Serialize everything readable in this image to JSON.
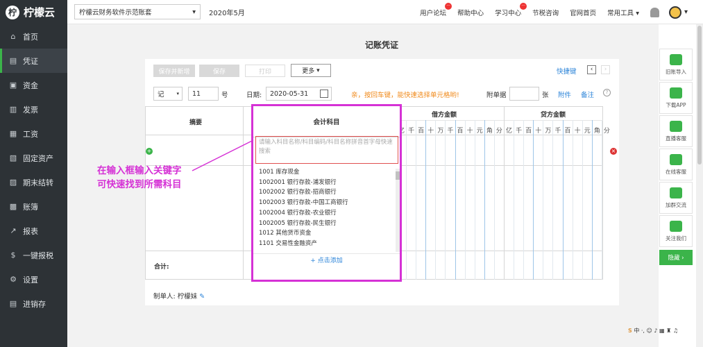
{
  "brand": {
    "name": "柠檬云",
    "logo_glyph": "柠"
  },
  "sidebar": {
    "items": [
      {
        "label": "首页",
        "icon": "home-icon",
        "glyph": "⌂"
      },
      {
        "label": "凭证",
        "icon": "voucher-icon",
        "glyph": "▤"
      },
      {
        "label": "资金",
        "icon": "funds-icon",
        "glyph": "▣"
      },
      {
        "label": "发票",
        "icon": "invoice-icon",
        "glyph": "▥"
      },
      {
        "label": "工资",
        "icon": "salary-icon",
        "glyph": "▦"
      },
      {
        "label": "固定资产",
        "icon": "asset-icon",
        "glyph": "▧"
      },
      {
        "label": "期末结转",
        "icon": "closing-icon",
        "glyph": "▨"
      },
      {
        "label": "账簿",
        "icon": "ledger-icon",
        "glyph": "▩"
      },
      {
        "label": "报表",
        "icon": "report-icon",
        "glyph": "↗"
      },
      {
        "label": "一键报税",
        "icon": "tax-icon",
        "glyph": "$"
      },
      {
        "label": "设置",
        "icon": "gear-icon",
        "glyph": "⚙"
      },
      {
        "label": "进销存",
        "icon": "inventory-icon",
        "glyph": "▤"
      }
    ]
  },
  "topbar": {
    "account": "柠檬云财务软件示范账套",
    "period": "2020年5月",
    "links": [
      "用户论坛",
      "帮助中心",
      "学习中心",
      "节税咨询",
      "官网首页",
      "常用工具"
    ],
    "badge": "···"
  },
  "voucher": {
    "title": "记账凭证",
    "btn_save_new": "保存并新增",
    "btn_save": "保存",
    "btn_print": "打印",
    "btn_more": "更多",
    "shortcut": "快捷键",
    "word": "记",
    "number": "11",
    "number_suffix": "号",
    "date_label": "日期:",
    "date_value": "2020-05-31",
    "hint": "亲，按回车键，能快速选择单元格哟!",
    "attach_label": "附单据",
    "attach_unit": "张",
    "attachment": "附件",
    "remark": "备注",
    "help": "?",
    "col_summary": "摘要",
    "col_subject": "会计科目",
    "col_debit": "借方金额",
    "col_credit": "贷方金额",
    "digits": [
      "亿",
      "千",
      "百",
      "十",
      "万",
      "千",
      "百",
      "十",
      "元",
      "角",
      "分"
    ],
    "total_label": "合计:",
    "maker_label": "制单人:",
    "maker": "柠檬妹"
  },
  "subject_popup": {
    "header": "会计科目",
    "placeholder": "请输入科目名称/科目编码/科目名称拼音首字母快速搜索",
    "options": [
      "1001 库存现金",
      "1002001 银行存款-浦发银行",
      "1002002 银行存款-招商银行",
      "1002003 银行存款-中国工商银行",
      "1002004 银行存款-农业银行",
      "1002005 银行存款-民生银行",
      "1012 其他货币资金",
      "1101 交易性金融资产"
    ],
    "add_link": "+ 点击添加"
  },
  "annotation": {
    "line1": "在输入框输入关键字",
    "line2": "可快速找到所需科目"
  },
  "right_panel": {
    "items": [
      {
        "label": "旧账导入",
        "icon": "import-icon"
      },
      {
        "label": "下载APP",
        "icon": "phone-icon"
      },
      {
        "label": "直播客服",
        "icon": "live-icon"
      },
      {
        "label": "在线客服",
        "icon": "service-icon"
      },
      {
        "label": "加群交流",
        "icon": "group-icon"
      },
      {
        "label": "关注我们",
        "icon": "wechat-icon"
      }
    ],
    "hide": "隐藏 ›"
  },
  "ime": {
    "s": "S",
    "text": "中 ·, ☺ ♪ ▦ ♜ ♫"
  },
  "colors": {
    "accent": "#3bb44a",
    "sidebar": "#2d3236",
    "annotation": "#d531d5",
    "link": "#2a83d8"
  }
}
